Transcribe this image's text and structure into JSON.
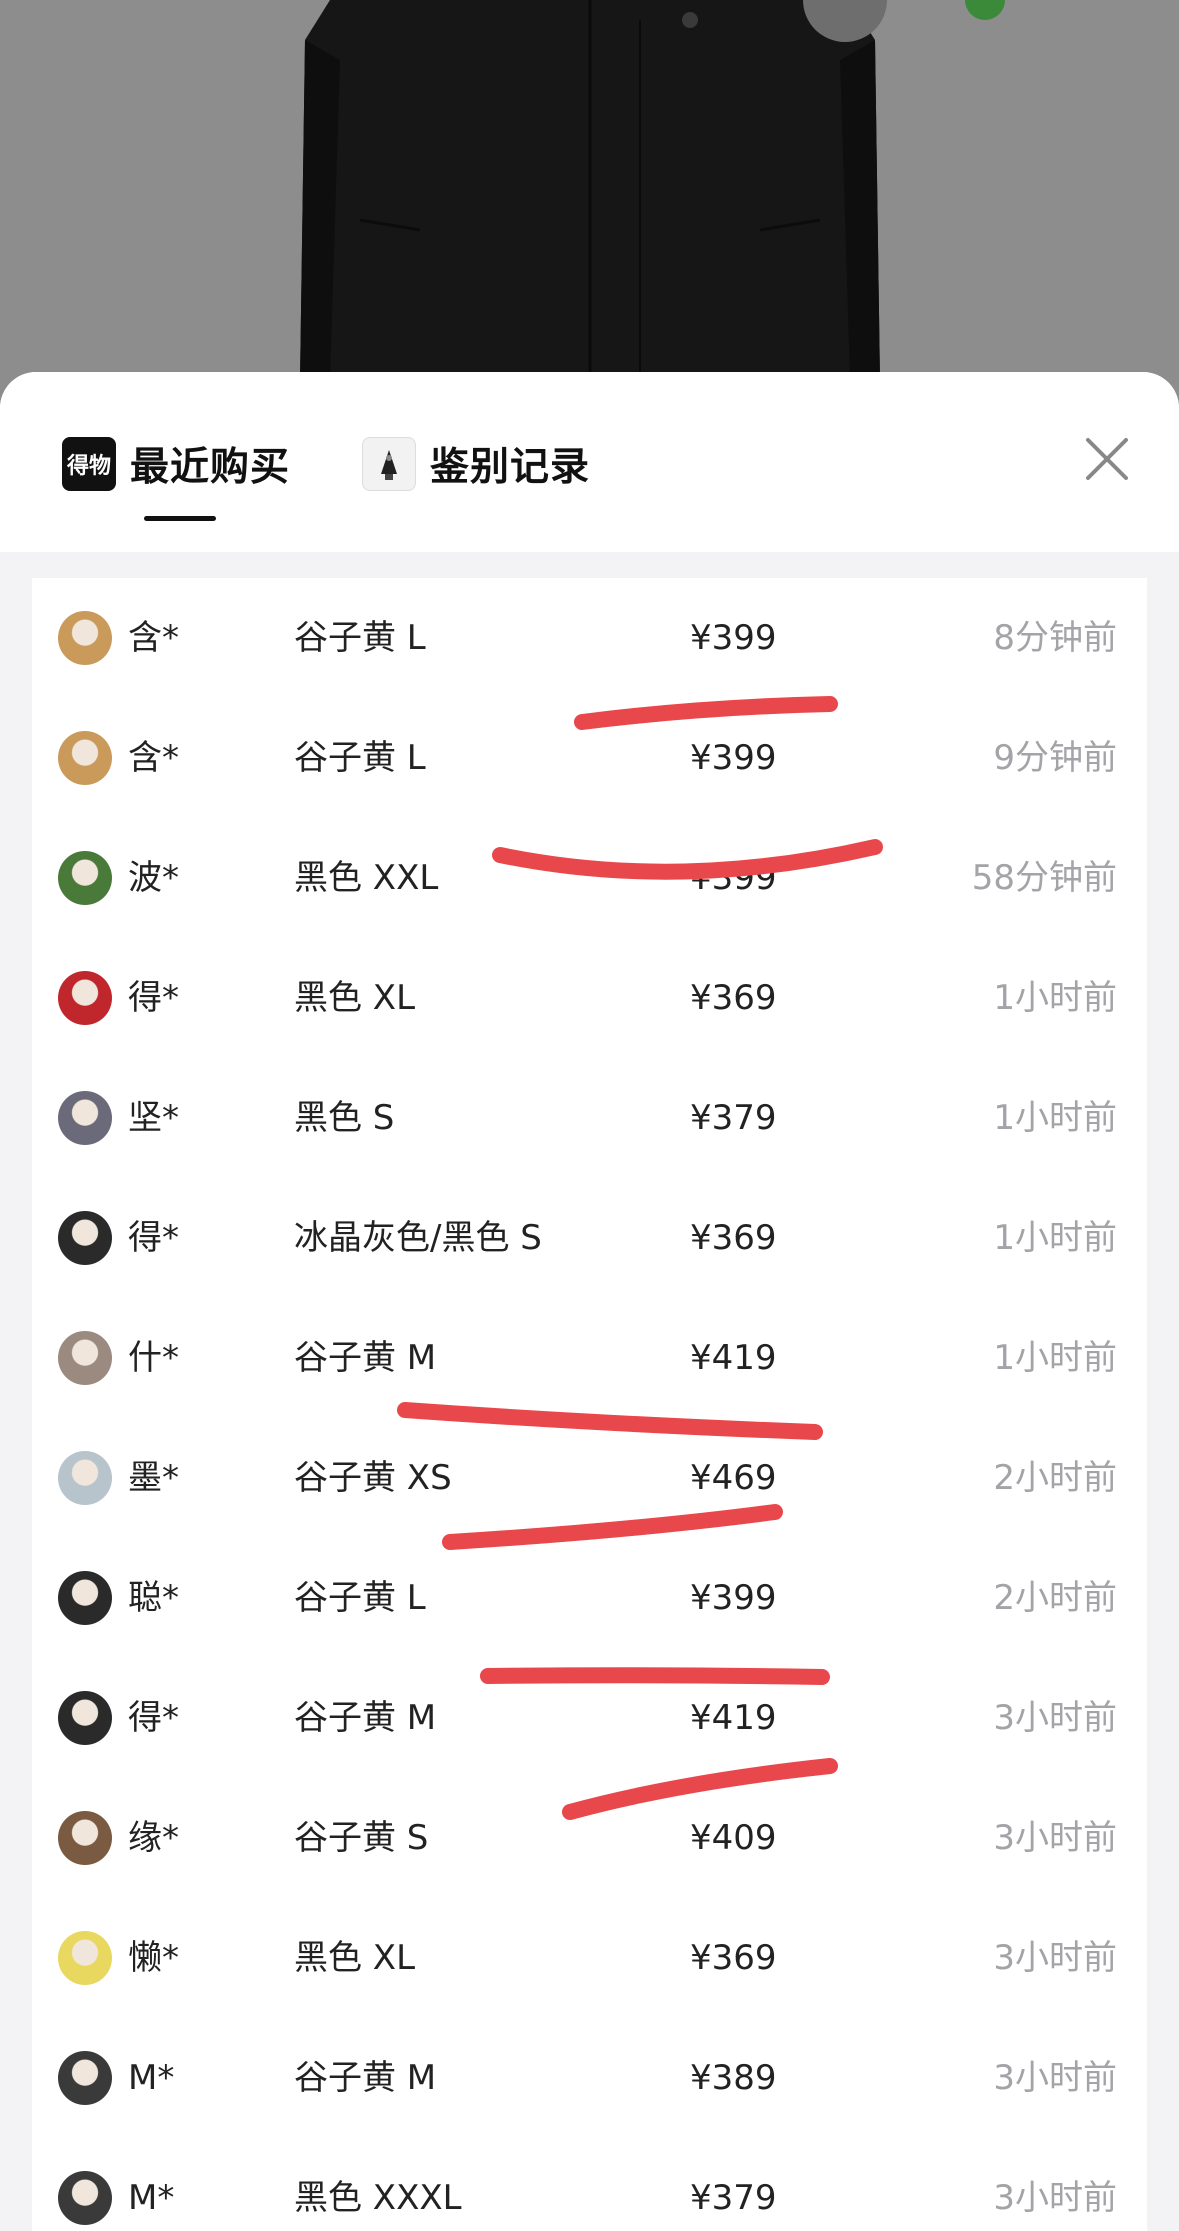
{
  "tabs": [
    {
      "label": "最近购买",
      "icon": "dewu-logo-icon",
      "icon_text": "得物",
      "active": true
    },
    {
      "label": "鉴别记录",
      "icon": "appraisal-icon",
      "active": false
    }
  ],
  "close_icon": "close-icon",
  "rows": [
    {
      "name": "含*",
      "spec": "谷子黄 L",
      "price": "¥399",
      "time": "8分钟前",
      "avatar_color": "#c99a5a"
    },
    {
      "name": "含*",
      "spec": "谷子黄 L",
      "price": "¥399",
      "time": "9分钟前",
      "avatar_color": "#c99a5a"
    },
    {
      "name": "波*",
      "spec": "黑色 XXL",
      "price": "¥399",
      "time": "58分钟前",
      "avatar_color": "#4a7a3a"
    },
    {
      "name": "得*",
      "spec": "黑色 XL",
      "price": "¥369",
      "time": "1小时前",
      "avatar_color": "#c0272d"
    },
    {
      "name": "坚*",
      "spec": "黑色 S",
      "price": "¥379",
      "time": "1小时前",
      "avatar_color": "#6a6a7a"
    },
    {
      "name": "得*",
      "spec": "冰晶灰色/黑色 S",
      "price": "¥369",
      "time": "1小时前",
      "avatar_color": "#2a2a2a"
    },
    {
      "name": "什*",
      "spec": "谷子黄 M",
      "price": "¥419",
      "time": "1小时前",
      "avatar_color": "#9a8a80"
    },
    {
      "name": "墨*",
      "spec": "谷子黄 XS",
      "price": "¥469",
      "time": "2小时前",
      "avatar_color": "#b8c4cc"
    },
    {
      "name": "聪*",
      "spec": "谷子黄 L",
      "price": "¥399",
      "time": "2小时前",
      "avatar_color": "#2a2a2a"
    },
    {
      "name": "得*",
      "spec": "谷子黄 M",
      "price": "¥419",
      "time": "3小时前",
      "avatar_color": "#2a2a2a"
    },
    {
      "name": "缘*",
      "spec": "谷子黄 S",
      "price": "¥409",
      "time": "3小时前",
      "avatar_color": "#7a5a40"
    },
    {
      "name": "懒*",
      "spec": "黑色 XL",
      "price": "¥369",
      "time": "3小时前",
      "avatar_color": "#e8d860"
    },
    {
      "name": "M*",
      "spec": "谷子黄 M",
      "price": "¥389",
      "time": "3小时前",
      "avatar_color": "#3a3a3a"
    },
    {
      "name": "M*",
      "spec": "黑色 XXXL",
      "price": "¥379",
      "time": "3小时前",
      "avatar_color": "#3a3a3a"
    }
  ],
  "annotation_color": "#e8484c"
}
